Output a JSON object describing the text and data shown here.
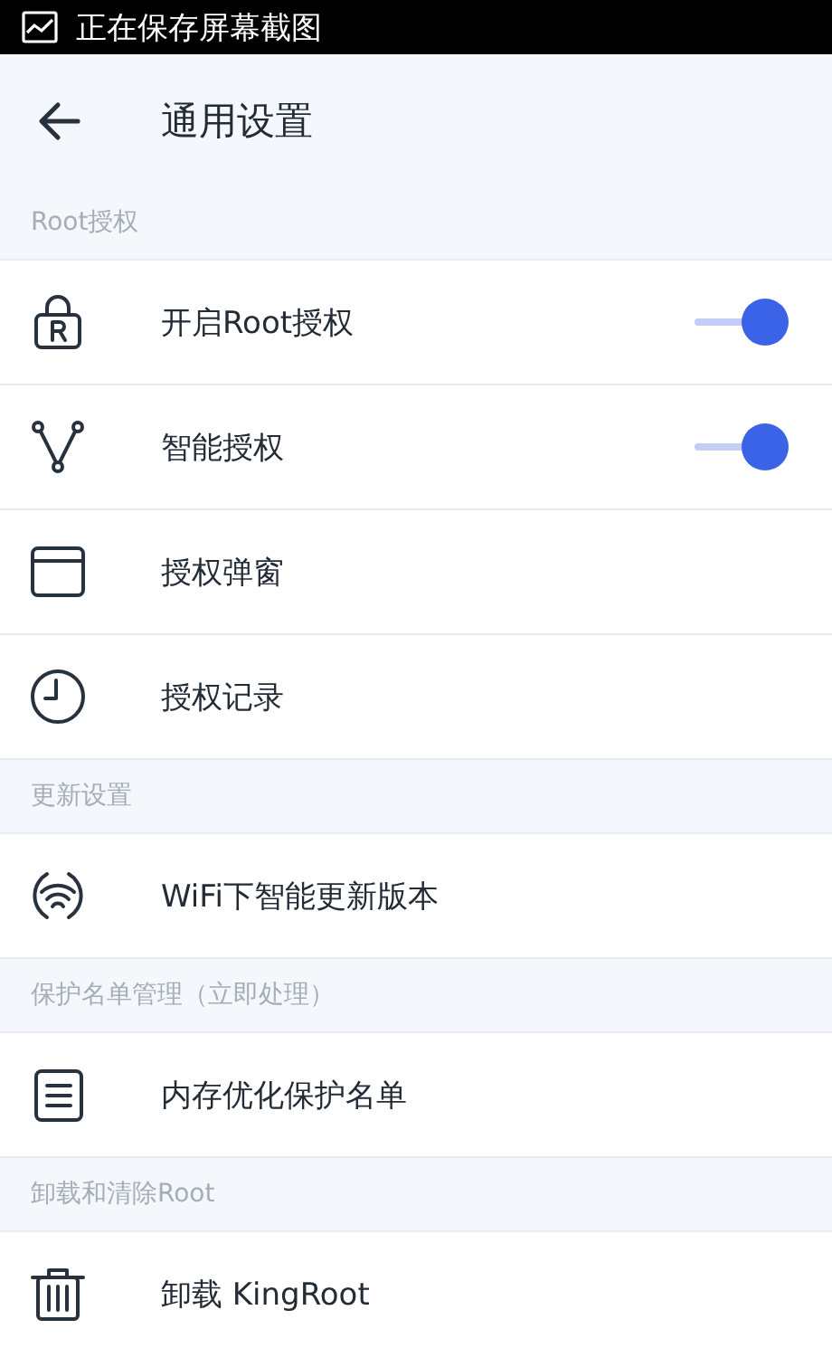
{
  "status_bar": {
    "text": "正在保存屏幕截图"
  },
  "header": {
    "title": "通用设置"
  },
  "sections": [
    {
      "title": "Root授权",
      "items": [
        {
          "label": "开启Root授权",
          "kind": "toggle",
          "on": true
        },
        {
          "label": "智能授权",
          "kind": "toggle",
          "on": true
        },
        {
          "label": "授权弹窗",
          "kind": "link"
        },
        {
          "label": "授权记录",
          "kind": "link"
        }
      ]
    },
    {
      "title": "更新设置",
      "items": [
        {
          "label": "WiFi下智能更新版本",
          "kind": "link"
        }
      ]
    },
    {
      "title": "保护名单管理（立即处理）",
      "items": [
        {
          "label": "内存优化保护名单",
          "kind": "link"
        }
      ]
    },
    {
      "title": "卸载和清除Root",
      "items": [
        {
          "label": "卸载 KingRoot",
          "kind": "link"
        }
      ]
    }
  ]
}
